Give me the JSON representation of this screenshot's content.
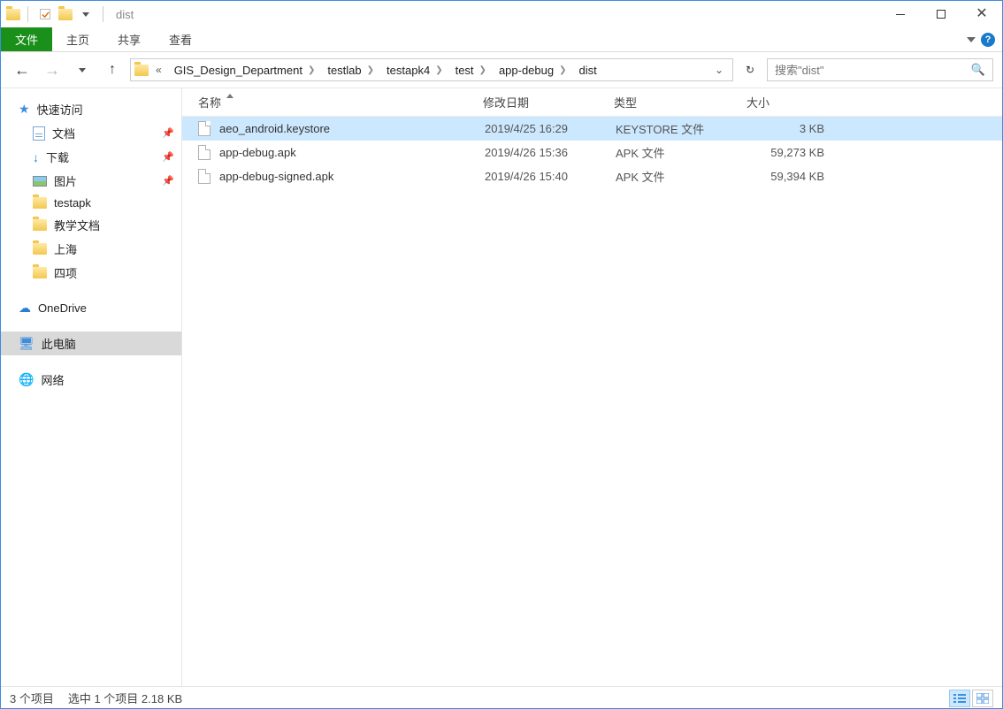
{
  "title": "dist",
  "tabs": {
    "file": "文件",
    "home": "主页",
    "share": "共享",
    "view": "查看"
  },
  "breadcrumbs": [
    "GIS_Design_Department",
    "testlab",
    "testapk4",
    "test",
    "app-debug",
    "dist"
  ],
  "search_placeholder": "搜索\"dist\"",
  "sidebar": {
    "quick": "快速访问",
    "docs": "文档",
    "downloads": "下载",
    "pictures": "图片",
    "testapk": "testapk",
    "teach": "教学文档",
    "shanghai": "上海",
    "four": "四项",
    "onedrive": "OneDrive",
    "thispc": "此电脑",
    "network": "网络"
  },
  "columns": {
    "name": "名称",
    "date": "修改日期",
    "type": "类型",
    "size": "大小"
  },
  "files": [
    {
      "name": "aeo_android.keystore",
      "date": "2019/4/25 16:29",
      "type": "KEYSTORE 文件",
      "size": "3 KB"
    },
    {
      "name": "app-debug.apk",
      "date": "2019/4/26 15:36",
      "type": "APK 文件",
      "size": "59,273 KB"
    },
    {
      "name": "app-debug-signed.apk",
      "date": "2019/4/26 15:40",
      "type": "APK 文件",
      "size": "59,394 KB"
    }
  ],
  "status": {
    "count": "3 个项目",
    "selection": "选中 1 个项目  2.18 KB"
  }
}
